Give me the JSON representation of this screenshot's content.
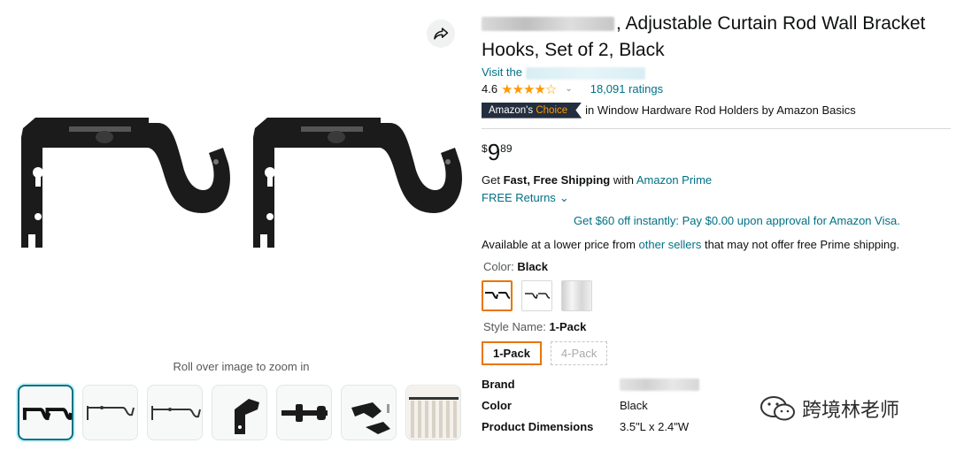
{
  "gallery": {
    "zoom_hint": "Roll over image to zoom in",
    "share_icon": "share-arrow-icon",
    "thumbnails": [
      {
        "name": "thumb-pair-black",
        "selected": true
      },
      {
        "name": "thumb-bracket-rod-1"
      },
      {
        "name": "thumb-bracket-rod-2"
      },
      {
        "name": "thumb-bracket-side"
      },
      {
        "name": "thumb-rod-end"
      },
      {
        "name": "thumb-bracket-parts"
      },
      {
        "name": "thumb-curtain-rod"
      }
    ]
  },
  "product": {
    "title_suffix": ", Adjustable Curtain Rod Wall Bracket Hooks, Set of 2, Black",
    "store_prefix": "Visit the",
    "rating_value": "4.6",
    "stars": "★★★★☆",
    "rating_count": "18,091 ratings",
    "badge_left": "Amazon's",
    "badge_right": "Choice",
    "badge_text": "in Window Hardware Rod Holders by Amazon Basics"
  },
  "price": {
    "symbol": "$",
    "whole": "9",
    "fraction": "89"
  },
  "shipping": {
    "prefix": "Get",
    "bold": "Fast, Free Shipping",
    "with": "with",
    "prime_link": "Amazon Prime",
    "returns": "FREE Returns",
    "returns_chevron": "⌄"
  },
  "offer": {
    "visa": "Get $60 off instantly: Pay $0.00 upon approval for Amazon Visa."
  },
  "lower_price": {
    "prefix": "Available at a lower price from",
    "link": "other sellers",
    "suffix": "that may not offer free Prime shipping."
  },
  "color": {
    "label": "Color:",
    "value": "Black",
    "options": [
      "black-bracket",
      "black-bracket-alt",
      "silver"
    ]
  },
  "style_name": {
    "label": "Style Name:",
    "value": "1-Pack",
    "options": [
      {
        "label": "1-Pack",
        "selected": true
      },
      {
        "label": "4-Pack",
        "disabled": true
      }
    ]
  },
  "specs": [
    {
      "key": "Brand",
      "value": ""
    },
    {
      "key": "Color",
      "value": "Black"
    },
    {
      "key": "Product Dimensions",
      "value": "3.5\"L x 2.4\"W"
    }
  ],
  "watermark": {
    "text": "跨境林老师"
  },
  "colors": {
    "link": "#007185",
    "accent": "#e77600",
    "star": "#ff9900",
    "badge_bg": "#232f3e"
  }
}
